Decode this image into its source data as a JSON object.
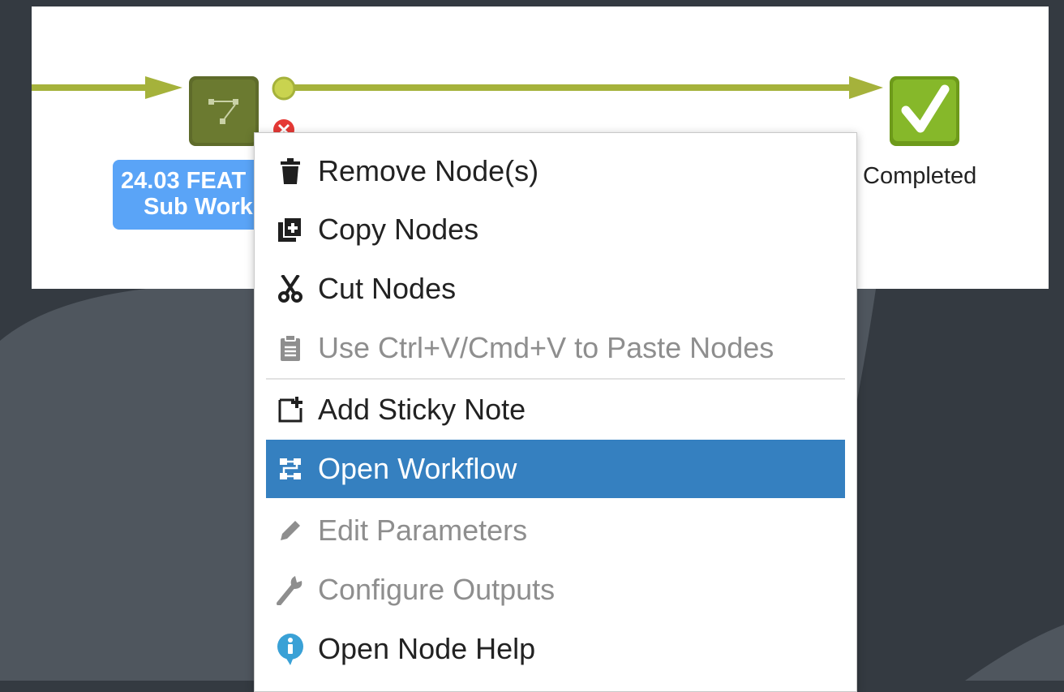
{
  "workflow": {
    "node_label_line1": "24.03 FEAT",
    "node_label_line2": "Sub Work",
    "end_node_label": "Completed",
    "colors": {
      "canvas": "#ffffff",
      "edge": "#a5b23b",
      "node": "#5e6b2a",
      "check": "#7fae1f",
      "label_bg": "#5aa4f7",
      "error": "#e53935"
    }
  },
  "context_menu": {
    "items": [
      {
        "label": "Remove Node(s)",
        "icon": "trash-icon",
        "enabled": true
      },
      {
        "label": "Copy Nodes",
        "icon": "copy-icon",
        "enabled": true
      },
      {
        "label": "Cut Nodes",
        "icon": "scissors-icon",
        "enabled": true
      },
      {
        "label": "Use Ctrl+V/Cmd+V to Paste Nodes",
        "icon": "clipboard-icon",
        "enabled": false
      },
      {
        "label": "Add Sticky Note",
        "icon": "sticky-note-icon",
        "enabled": true
      },
      {
        "label": "Open Workflow",
        "icon": "workflow-icon",
        "enabled": true,
        "highlighted": true
      },
      {
        "label": "Edit Parameters",
        "icon": "pencil-icon",
        "enabled": false
      },
      {
        "label": "Configure Outputs",
        "icon": "wrench-icon",
        "enabled": false
      },
      {
        "label": "Open Node Help",
        "icon": "info-icon",
        "enabled": true
      }
    ],
    "highlight_color": "#3580c0"
  }
}
